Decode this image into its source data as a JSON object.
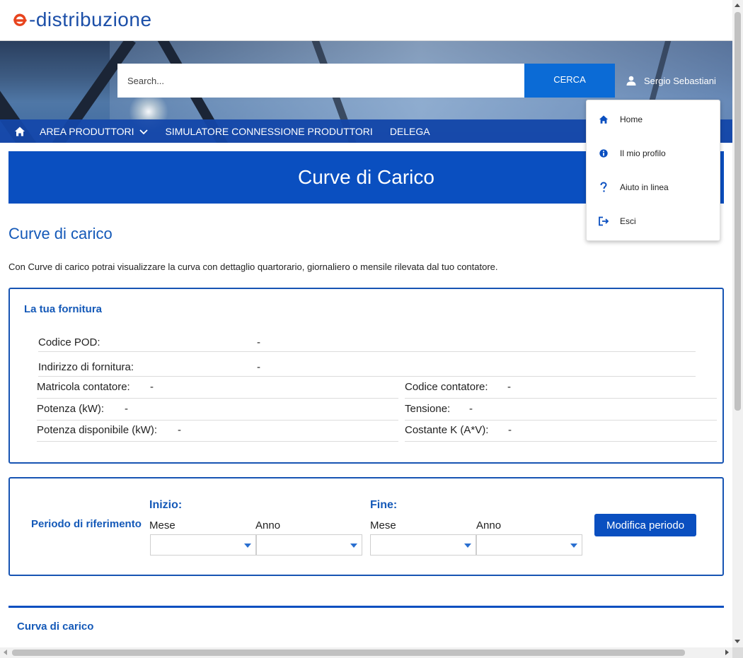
{
  "header": {
    "logo_text": "-distribuzione",
    "logo_alt": "e-distribuzione"
  },
  "search": {
    "placeholder": "Search...",
    "button_label": "CERCA"
  },
  "user": {
    "name": "Sergio Sebastiani"
  },
  "nav": {
    "items": [
      {
        "label": "AREA PRODUTTORI",
        "has_dropdown": true
      },
      {
        "label": "SIMULATORE CONNESSIONE PRODUTTORI"
      },
      {
        "label": "DELEGA"
      }
    ]
  },
  "user_dropdown": {
    "items": [
      {
        "label": "Home",
        "icon": "home-icon"
      },
      {
        "label": "Il mio profilo",
        "icon": "info-icon"
      },
      {
        "label": "Aiuto in linea",
        "icon": "question-icon"
      },
      {
        "label": "Esci",
        "icon": "logout-icon"
      }
    ]
  },
  "page": {
    "banner_title": "Curve di Carico",
    "section_title": "Curve di carico",
    "intro": "Con Curve di carico potrai visualizzare la curva con dettaglio quartorario, giornaliero o mensile rilevata dal tuo contatore."
  },
  "supply": {
    "title": "La tua fornitura",
    "pod_label": "Codice POD:",
    "pod_value": "-",
    "address_label": "Indirizzo di fornitura:",
    "address_value": "-",
    "meter_serial_label": "Matricola contatore:",
    "meter_serial_value": "-",
    "meter_code_label": "Codice contatore:",
    "meter_code_value": "-",
    "power_label": "Potenza (kW):",
    "power_value": "-",
    "voltage_label": "Tensione:",
    "voltage_value": "-",
    "available_power_label": "Potenza disponibile (kW):",
    "available_power_value": "-",
    "k_constant_label": "Costante K (A*V):",
    "k_constant_value": "-"
  },
  "period": {
    "label": "Periodo di riferimento",
    "start_title": "Inizio:",
    "end_title": "Fine:",
    "month_label": "Mese",
    "year_label": "Anno",
    "start_month_value": "",
    "start_year_value": "",
    "end_month_value": "",
    "end_year_value": "",
    "modify_button": "Modifica periodo"
  },
  "curve": {
    "title": "Curva di carico"
  },
  "colors": {
    "brand_blue": "#0a4fc0",
    "button_blue": "#0b6bd6",
    "logo_red": "#e8441e",
    "heading_blue": "#1459b8"
  }
}
